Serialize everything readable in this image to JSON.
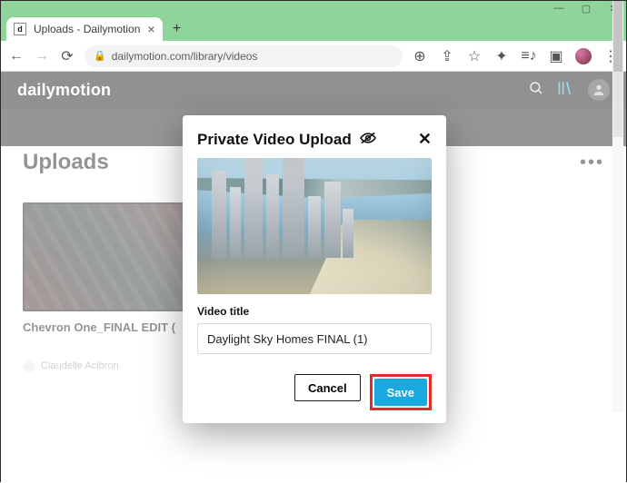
{
  "browser": {
    "tab_title": "Uploads - Dailymotion",
    "url": "dailymotion.com/library/videos"
  },
  "header": {
    "brand": "dailymotion"
  },
  "page": {
    "heading": "Uploads",
    "card": {
      "title": "Chevron One_FINAL EDIT (",
      "author": "Claudelle Acibron"
    }
  },
  "modal": {
    "title": "Private Video Upload",
    "label_video_title": "Video title",
    "input_value": "Daylight Sky Homes FINAL (1)",
    "cancel": "Cancel",
    "save": "Save"
  }
}
